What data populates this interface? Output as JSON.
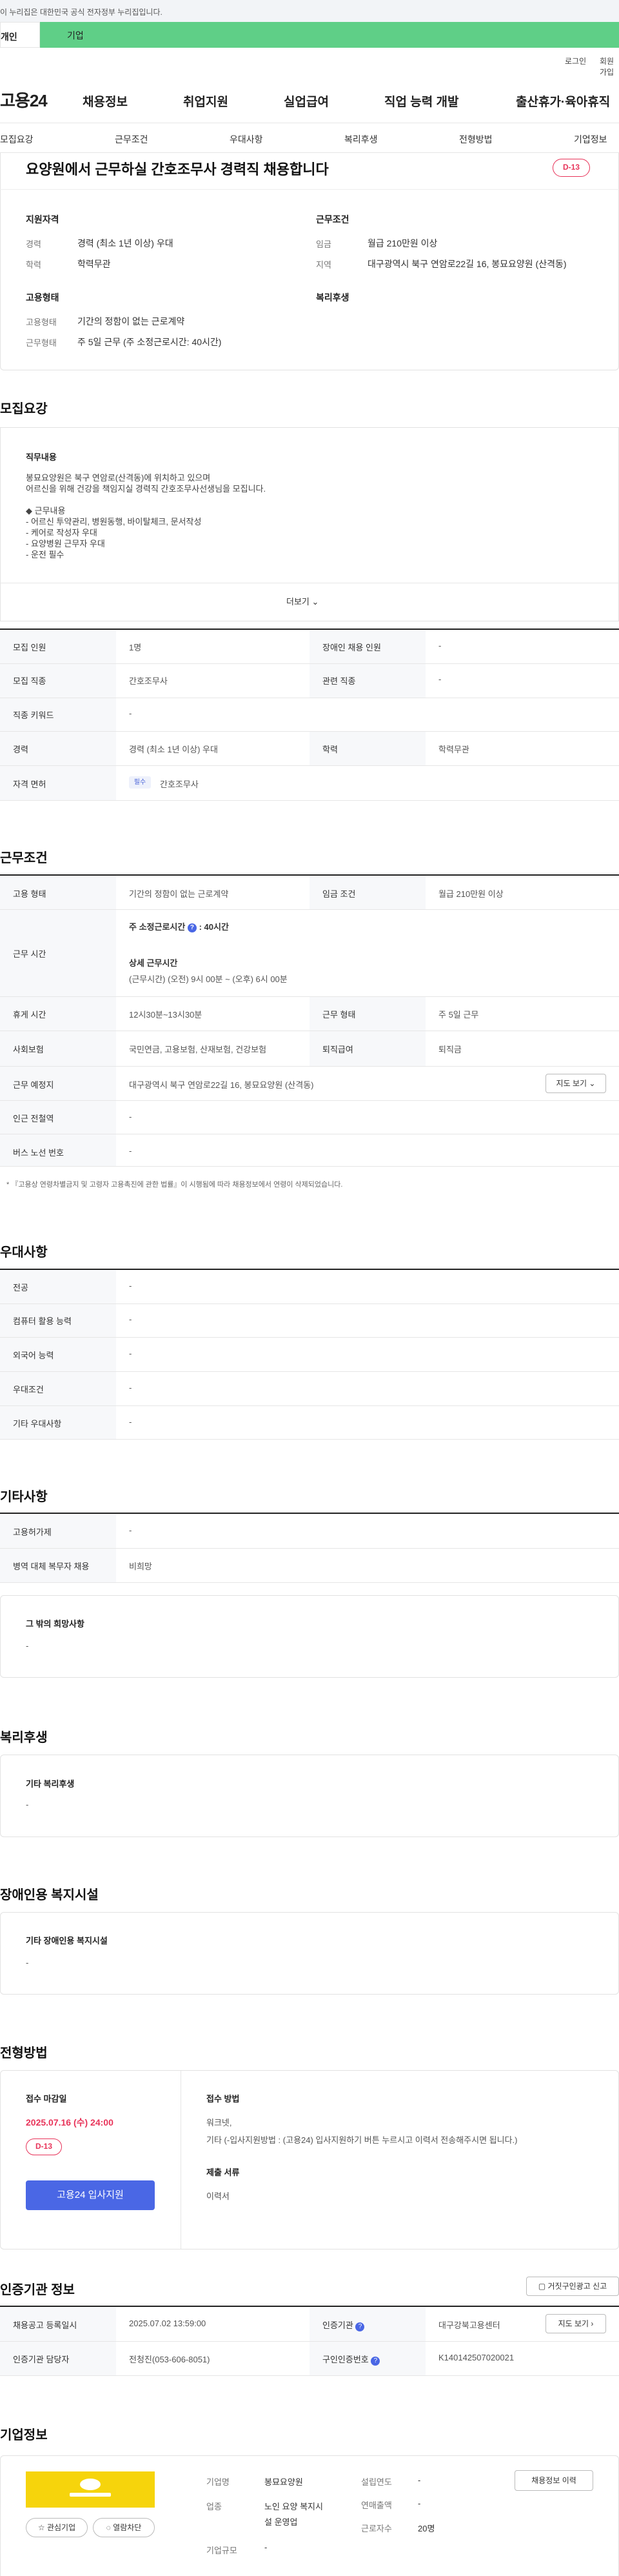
{
  "gov": "이 누리집은 대한민국 공식 전자정부 누리집입니다.",
  "tabs": {
    "indiv": "개인",
    "corp": "기업"
  },
  "util": {
    "login": "로그인",
    "join": "회원가입"
  },
  "logo": "고용24",
  "gnb": [
    "채용정보",
    "취업지원",
    "실업급여",
    "직업 능력 개발",
    "출산휴가·육아휴직"
  ],
  "subnav": [
    "모집요강",
    "근무조건",
    "우대사항",
    "복리후생",
    "전형방법",
    "기업정보"
  ],
  "summary": {
    "title": "요양원에서 근무하실 간호조무사 경력직 채용합니다",
    "dday": "D-13",
    "qual_h": "지원자격",
    "cond_h": "근무조건",
    "form_h": "고용형태",
    "welfare_h": "복리후생",
    "career_k": "경력",
    "career_v": "경력 (최소 1년 이상) 우대",
    "edu_k": "학력",
    "edu_v": "학력무관",
    "wage_k": "임금",
    "wage_v": "월급 210만원 이상",
    "area_k": "지역",
    "area_v": "대구광역시 북구 연암로22길 16, 봉묘요양원 (산격동)",
    "etype_k": "고용형태",
    "etype_v": "기간의 정함이 없는 근로계약",
    "wform_k": "근무형태",
    "wform_v": "주 5일 근무 (주 소정근로시간: 40시간)"
  },
  "recruit": {
    "title": "모집요강",
    "content_h": "직무내용",
    "content": [
      "봉묘요양원은 북구 연암로(산격동)에 위치하고 있으며",
      "어르신을 위해 건강을 책임지실 경력직 간호조무사선생님을 모집니다.",
      "",
      "◆ 근무내용",
      "- 어르신 투약관리, 병원동행,  바이탈체크, 문서작성",
      "- 케어로 작성자 우대",
      "- 요양병원 근무자 우대",
      "- 운전 필수"
    ],
    "more": "더보기",
    "rows": [
      {
        "k1": "모집 인원",
        "v1": "1명",
        "k2": "장애인 채용 인원",
        "v2": "-"
      },
      {
        "k1": "모집 직종",
        "v1": "간호조무사",
        "k2": "관련 직종",
        "v2": "-"
      },
      {
        "k1": "직종 키워드",
        "v1": "-"
      },
      {
        "k1": "경력",
        "v1": "경력 (최소 1년 이상) 우대",
        "k2": "학력",
        "v2": "학력무관"
      },
      {
        "k1": "자격 면허",
        "tag": "필수",
        "v1": "간호조무사"
      }
    ]
  },
  "conditions": {
    "title": "근무조건",
    "etype_k": "고용 형태",
    "etype_v": "기간의 정함이 없는 근로계약",
    "wage_k": "임금 조건",
    "wage_v": "월급 210만원 이상",
    "time_k": "근무 시간",
    "time_week": "주 소정근로시간",
    "time_week_v": ": 40시간",
    "time_detail_h": "상세 근무시간",
    "time_detail_v": "(근무시간) (오전) 9시 00분 ~ (오후) 6시 00분",
    "break_k": "휴게 시간",
    "break_v": "12시30분~13시30분",
    "wform_k": "근무 형태",
    "wform_v": "주 5일 근무",
    "ins_k": "사회보험",
    "ins_v": "국민연금, 고용보험, 산재보험, 건강보험",
    "ret_k": "퇴직급여",
    "ret_v": "퇴직금",
    "place_k": "근무 예정지",
    "place_v": "대구광역시 북구 연암로22길 16, 봉묘요양원 (산격동)",
    "map_btn": "지도 보기",
    "station_k": "인근 전철역",
    "station_v": "-",
    "bus_k": "버스 노선 번호",
    "bus_v": "-",
    "note": "* 『고용상 연령차별금지 및 고령자 고용촉진에 관한 법률』이 시행됨에 따라 채용정보에서 연령이 삭제되었습니다."
  },
  "preference": {
    "title": "우대사항",
    "rows": [
      {
        "k": "전공",
        "v": "-"
      },
      {
        "k": "컴퓨터 활용 능력",
        "v": "-"
      },
      {
        "k": "외국어 능력",
        "v": "-"
      },
      {
        "k": "우대조건",
        "v": "-"
      },
      {
        "k": "기타 우대사항",
        "v": "-"
      }
    ]
  },
  "etc": {
    "title": "기타사항",
    "rows": [
      {
        "k": "고용허가제",
        "v": "-"
      },
      {
        "k": "병역 대체 복무자 채용",
        "v": "비희망"
      }
    ],
    "other_h": "그 밖의 희망사항",
    "other_v": "-"
  },
  "welfare": {
    "title": "복리후생",
    "h": "기타 복리후생",
    "v": "-"
  },
  "disabled": {
    "title": "장애인용 복지시설",
    "h": "기타 장애인용 복지시설",
    "v": "-"
  },
  "selection": {
    "title": "전형방법",
    "deadline_h": "접수 마감일",
    "deadline_v": "2025.07.16 (수) 24:00",
    "dday": "D-13",
    "apply": "고용24 입사지원",
    "method_h": "접수 방법",
    "method_v1": "워크넷,",
    "method_v2": "기타 (-입사지원방법 : (고용24) 입사지원하기 버튼 누르시고 이력서 전송해주시면 됩니다.)",
    "docs_h": "제출 서류",
    "docs_v": "이력서"
  },
  "cert": {
    "title": "인증기관 정보",
    "report_btn": "거짓구인광고 신고",
    "r1k1": "채용공고 등록일시",
    "r1v1": "2025.07.02 13:59:00",
    "r1k2": "인증기관",
    "r1v2": "대구강북고용센터",
    "map_btn": "지도 보기",
    "r2k1": "인증기관 담당자",
    "r2v1": "전청진(053-606-8051)",
    "r2k2": "구인인증번호",
    "r2v2": "K140142507020021"
  },
  "company": {
    "title": "기업정보",
    "fav": "관심기업",
    "block": "열람차단",
    "name_k": "기업명",
    "name_v": "봉묘요양원",
    "ind_k": "업종",
    "ind_v1": "노인 요양 복지시",
    "ind_v2": "설 운영업",
    "size_k": "기업규모",
    "size_v": "-",
    "est_k": "설립연도",
    "est_v": "-",
    "sales_k": "연매출액",
    "sales_v": "-",
    "emp_k": "근로자수",
    "emp_v": "20명",
    "history_btn": "채용정보 이력"
  }
}
